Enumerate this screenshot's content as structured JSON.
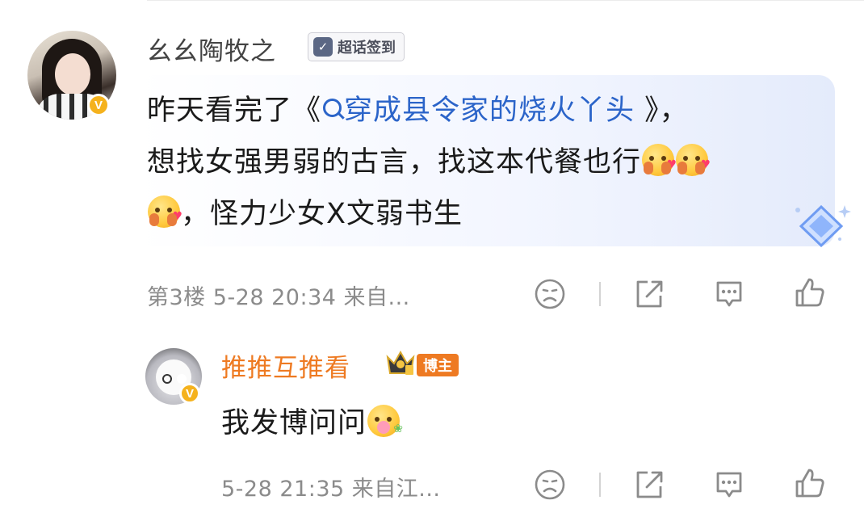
{
  "main_comment": {
    "username": "幺幺陶牧之",
    "supertopic_badge": "超话签到",
    "text_line1_prefix": "昨天看完了《",
    "text_link": "穿成县令家的烧火丫头 ",
    "text_line1_suffix": "》，",
    "text_line2": "想找女强男弱的古言，找这本代餐也行",
    "text_line3": "，怪力少女X文弱书生",
    "meta": "第3楼 5-28 20:34 来自..."
  },
  "reply": {
    "username": "推推互推看",
    "role_badge": "博主",
    "text": "我发博问问",
    "meta": "5-28 21:35 来自江..."
  },
  "icons": {
    "verified": "verified-badge-icon",
    "dislike": "sad-face-icon",
    "share": "share-icon",
    "comment": "comment-icon",
    "like": "thumbs-up-icon",
    "crown": "crown-icon"
  },
  "colors": {
    "link": "#2b64c9",
    "verified": "#f5b21d",
    "blogger_accent": "#ee7a22",
    "meta_text": "#8b8b8b"
  }
}
